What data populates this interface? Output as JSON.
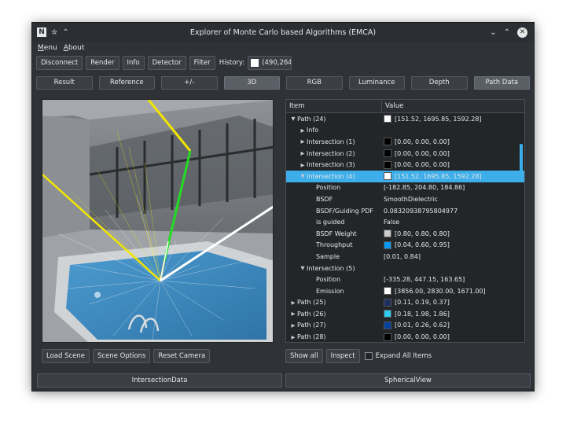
{
  "window": {
    "title": "Explorer of Monte Carlo based Algorithms (EMCA)",
    "app_icon": "N",
    "left_icons": [
      "pin-icon",
      "keep-above-icon"
    ],
    "right_icons": [
      "minimize-icon",
      "maximize-icon",
      "close-icon"
    ]
  },
  "menu": {
    "items": [
      "Menu",
      "About"
    ]
  },
  "toolbar": {
    "disconnect": "Disconnect",
    "render": "Render",
    "info": "Info",
    "detector": "Detector",
    "filter": "Filter",
    "history_label": "History:",
    "history_value": "(490,264"
  },
  "tabs": [
    {
      "label": "Result",
      "active": false
    },
    {
      "label": "Reference",
      "active": false
    },
    {
      "label": "+/-",
      "active": false
    },
    {
      "label": "3D",
      "active": true
    },
    {
      "label": "RGB",
      "active": false
    },
    {
      "label": "Luminance",
      "active": false
    },
    {
      "label": "Depth",
      "active": false
    },
    {
      "label": "Path Data",
      "active": true
    }
  ],
  "viewport_buttons": {
    "load_scene": "Load Scene",
    "scene_options": "Scene Options",
    "reset_camera": "Reset Camera"
  },
  "tree": {
    "columns": [
      "Item",
      "Value"
    ],
    "rows": [
      {
        "indent": 0,
        "arrow": "down",
        "item": "Path (24)",
        "swatch": "#ffffff",
        "value": "[151.52, 1695.85, 1592.28]",
        "selected": false
      },
      {
        "indent": 1,
        "arrow": "right",
        "item": "Info",
        "swatch": null,
        "value": "",
        "selected": false
      },
      {
        "indent": 1,
        "arrow": "right",
        "item": "Intersection (1)",
        "swatch": "#000000",
        "value": "[0.00, 0.00, 0.00]",
        "selected": false
      },
      {
        "indent": 1,
        "arrow": "right",
        "item": "Intersection (2)",
        "swatch": "#000000",
        "value": "[0.00, 0.00, 0.00]",
        "selected": false
      },
      {
        "indent": 1,
        "arrow": "right",
        "item": "Intersection (3)",
        "swatch": "#000000",
        "value": "[0.00, 0.00, 0.00]",
        "selected": false
      },
      {
        "indent": 1,
        "arrow": "down",
        "item": "Intersection (4)",
        "swatch": "#ffffff",
        "value": "[151.52, 1695.85, 1592.28]",
        "selected": true
      },
      {
        "indent": 2,
        "arrow": "",
        "item": "Position",
        "swatch": null,
        "value": "[-182.85, 204.80, 184.86]",
        "selected": false
      },
      {
        "indent": 2,
        "arrow": "",
        "item": "BSDF",
        "swatch": null,
        "value": "SmoothDielectric",
        "selected": false
      },
      {
        "indent": 2,
        "arrow": "",
        "item": "BSDF/Guiding PDF",
        "swatch": null,
        "value": "0.08320938795804977",
        "selected": false
      },
      {
        "indent": 2,
        "arrow": "",
        "item": "is guided",
        "swatch": null,
        "value": "False",
        "selected": false
      },
      {
        "indent": 2,
        "arrow": "",
        "item": "BSDF Weight",
        "swatch": "#cccccc",
        "value": "[0.80, 0.80, 0.80]",
        "selected": false
      },
      {
        "indent": 2,
        "arrow": "",
        "item": "Throughput",
        "swatch": "#0a99f2",
        "value": "[0.04, 0.60, 0.95]",
        "selected": false
      },
      {
        "indent": 2,
        "arrow": "",
        "item": "Sample",
        "swatch": null,
        "value": "[0.01, 0.84]",
        "selected": false
      },
      {
        "indent": 1,
        "arrow": "down",
        "item": "Intersection (5)",
        "swatch": null,
        "value": "",
        "selected": false
      },
      {
        "indent": 2,
        "arrow": "",
        "item": "Position",
        "swatch": null,
        "value": "[-335.28, 447.15, 163.65]",
        "selected": false
      },
      {
        "indent": 2,
        "arrow": "",
        "item": "Emission",
        "swatch": "#ffffff",
        "value": "[3856.00, 2830.00, 1671.00]",
        "selected": false
      },
      {
        "indent": 0,
        "arrow": "right",
        "item": "Path (25)",
        "swatch": "#1c305e",
        "value": "[0.11, 0.19, 0.37]",
        "selected": false
      },
      {
        "indent": 0,
        "arrow": "right",
        "item": "Path (26)",
        "swatch": "#2ecbee",
        "value": "[0.18, 1.98, 1.86]",
        "selected": false
      },
      {
        "indent": 0,
        "arrow": "right",
        "item": "Path (27)",
        "swatch": "#03429e",
        "value": "[0.01, 0.26, 0.62]",
        "selected": false
      },
      {
        "indent": 0,
        "arrow": "right",
        "item": "Path (28)",
        "swatch": "#000000",
        "value": "[0.00, 0.00, 0.00]",
        "selected": false
      }
    ]
  },
  "tree_buttons": {
    "show_all": "Show all",
    "inspect": "Inspect",
    "expand_all": "Expand All Items",
    "expand_all_checked": false
  },
  "bottom_tabs": {
    "intersection_data": "IntersectionData",
    "spherical_view": "SphericalView"
  },
  "colors": {
    "selection": "#3daee9",
    "path_yellow": "#f2e600",
    "path_green": "#22dd22",
    "path_white": "#ffffff",
    "water": "#3d89c0"
  }
}
